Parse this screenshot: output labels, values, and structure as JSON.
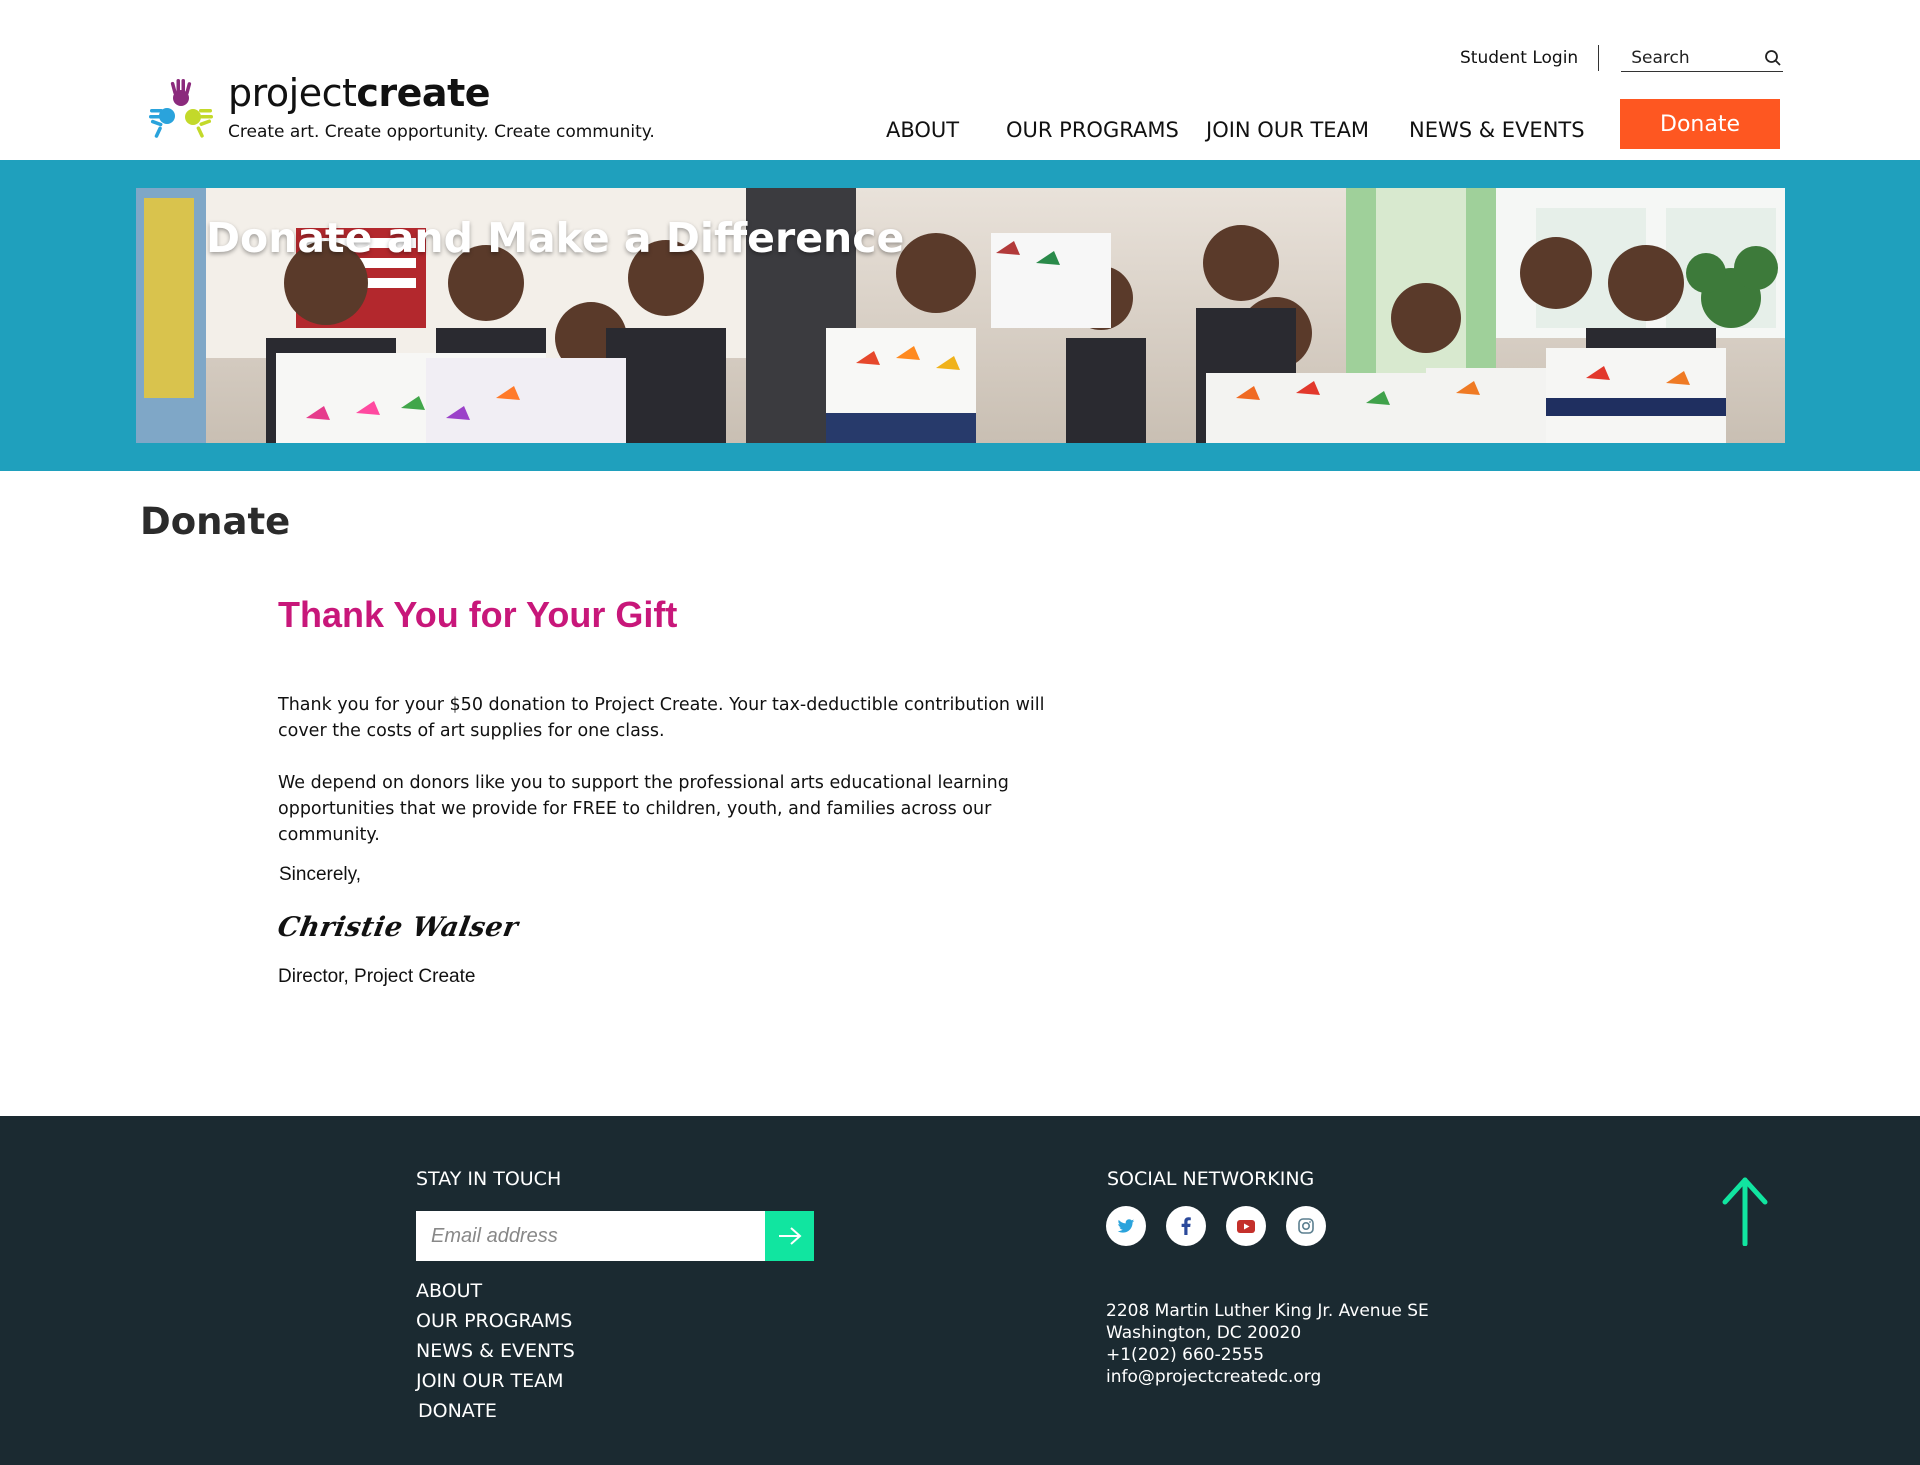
{
  "header": {
    "brand_light": "project",
    "brand_bold": "create",
    "tagline": "Create art. Create opportunity. Create community.",
    "student_login": "Student Login",
    "search_placeholder": "Search",
    "nav": [
      "ABOUT",
      "OUR PROGRAMS",
      "JOIN OUR TEAM",
      "NEWS & EVENTS"
    ],
    "donate": "Donate"
  },
  "hero": {
    "title": "Donate and Make a Difference"
  },
  "main": {
    "page_title": "Donate",
    "heading": "Thank You for Your Gift",
    "paragraph_1": "Thank you for your $50 donation to Project Create.  Your tax-deductible contribution will cover the costs of art supplies for one class.",
    "paragraph_2": "We depend on donors like you to support the professional arts educational learning opportunities that we provide for FREE to children, youth, and families across our community.",
    "sign_off": "Sincerely,",
    "signature": "Christie Walser",
    "signer_title": "Director, Project Create"
  },
  "footer": {
    "stay_heading": "STAY IN TOUCH",
    "email_placeholder": "Email address",
    "links": [
      "ABOUT",
      "OUR PROGRAMS",
      "NEWS & EVENTS",
      "JOIN OUR TEAM",
      "DONATE"
    ],
    "social_heading": "SOCIAL NETWORKING",
    "social_icons": [
      "twitter-icon",
      "facebook-icon",
      "youtube-icon",
      "instagram-icon"
    ],
    "address_line_1": "2208 Martin Luther King Jr. Avenue SE",
    "address_line_2": "Washington, DC 20020",
    "phone": "+1(202) 660-2555",
    "email": "info@projectcreatedc.org"
  },
  "colors": {
    "accent_orange": "#fe5721",
    "hero_teal": "#1fa0bd",
    "heading_magenta": "#c8177a",
    "footer_bg": "#1b2a31",
    "footer_accent": "#11e5a0"
  }
}
